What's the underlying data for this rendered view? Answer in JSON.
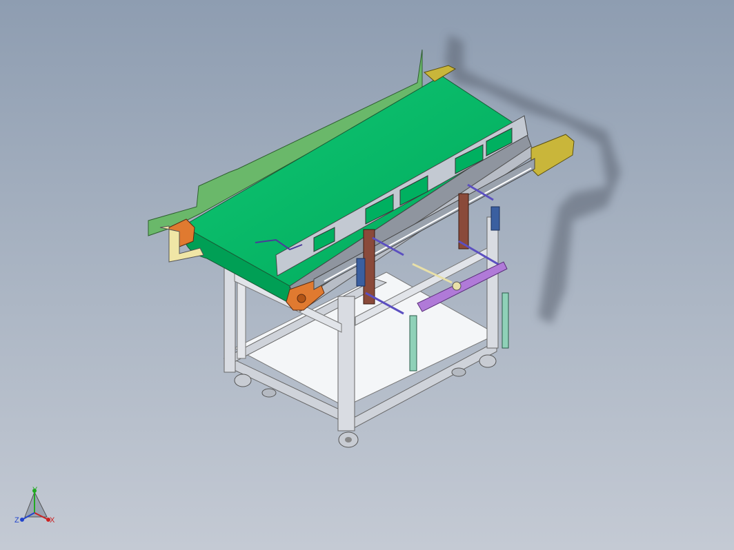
{
  "triad": {
    "x_label": "X",
    "y_label": "Y",
    "z_label": "Z"
  },
  "colors": {
    "background_top": "#8e9db1",
    "background_bottom": "#c4cad4",
    "belt_green": "#00bb66",
    "guard_green": "#6ab86a",
    "pulley_orange": "#e07a30",
    "end_plate_yellow": "#c9b63a",
    "frame_gray": "#d6d9df",
    "bracket_brown": "#8a4a3a",
    "bracket_blue": "#3a5fa0",
    "link_purple": "#b07ad8",
    "link_teal": "#8fd1b8",
    "axis_x": "#cc2222",
    "axis_y": "#22aa22",
    "axis_z": "#2244cc"
  },
  "icons": [
    "coordinate-triad-icon"
  ]
}
